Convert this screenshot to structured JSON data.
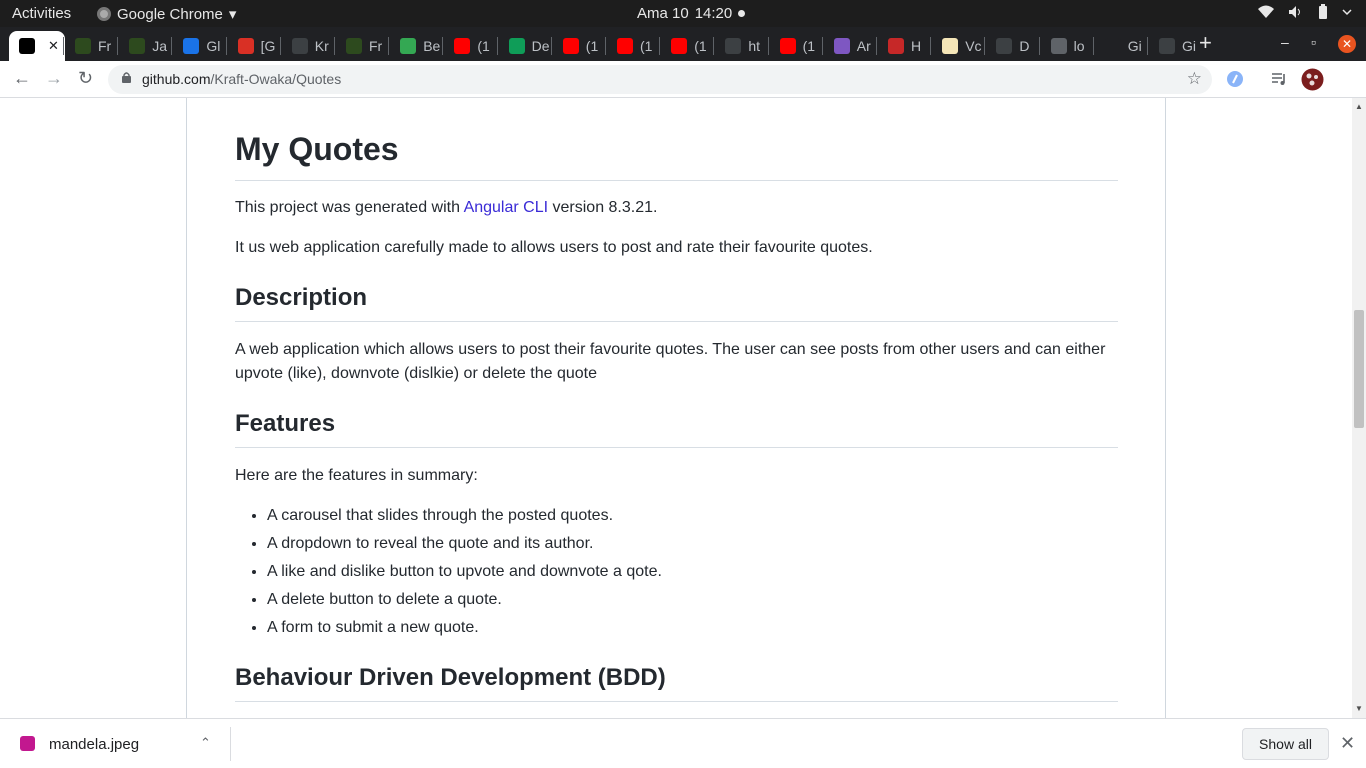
{
  "system": {
    "activities": "Activities",
    "app_name": "Google Chrome",
    "app_menu_arrow": "▾",
    "date": "Ama 10",
    "time": "14:20"
  },
  "tabs": [
    {
      "label": "",
      "active": true,
      "close": "✕",
      "icon": "github-icon",
      "color": "#000000"
    },
    {
      "label": "Fr",
      "icon": "palm-icon",
      "color": "#2d4a1e"
    },
    {
      "label": "Ja",
      "icon": "palm-icon",
      "color": "#2d4a1e"
    },
    {
      "label": "Gl",
      "icon": "gdoc-icon",
      "color": "#1a73e8"
    },
    {
      "label": "[G",
      "icon": "gmail-icon",
      "color": "#d93025"
    },
    {
      "label": "Kr",
      "icon": "github-icon",
      "color": "#3c4043"
    },
    {
      "label": "Fr",
      "icon": "palm-icon",
      "color": "#2d4a1e"
    },
    {
      "label": "Be",
      "icon": "leaf-icon",
      "color": "#34a853"
    },
    {
      "label": "(1",
      "icon": "youtube-icon",
      "color": "#ff0000"
    },
    {
      "label": "De",
      "icon": "stack-icon",
      "color": "#0f9d58"
    },
    {
      "label": "(1",
      "icon": "youtube-icon",
      "color": "#ff0000"
    },
    {
      "label": "(1",
      "icon": "youtube-icon",
      "color": "#ff0000"
    },
    {
      "label": "(1",
      "icon": "youtube-icon",
      "color": "#ff0000"
    },
    {
      "label": "ht",
      "icon": "globe-icon",
      "color": "#3c4043"
    },
    {
      "label": "(1",
      "icon": "youtube-icon",
      "color": "#ff0000"
    },
    {
      "label": "Ar",
      "icon": "react-icon",
      "color": "#7e57c2"
    },
    {
      "label": "H",
      "icon": "heroku-icon",
      "color": "#c62828"
    },
    {
      "label": "Vc",
      "icon": "grammar-icon",
      "color": "#f5e6b8"
    },
    {
      "label": "D",
      "icon": "github-icon",
      "color": "#3c4043"
    },
    {
      "label": "lo",
      "icon": "globe-icon",
      "color": "#5f6368"
    },
    {
      "label": "Gi",
      "icon": "angular-icon",
      "color": "#202124"
    },
    {
      "label": "Gi",
      "icon": "github-icon",
      "color": "#3c4043"
    }
  ],
  "new_tab": "+",
  "window": {
    "minimize": "–",
    "maximize": "▫",
    "close": "✕"
  },
  "toolbar": {
    "back": "←",
    "forward": "→",
    "reload": "↻",
    "url_domain": "github.com",
    "url_path": "/Kraft-Owaka/Quotes",
    "star": "☆"
  },
  "readme": {
    "title": "My Quotes",
    "intro_prefix": "This project was generated with ",
    "intro_link": "Angular CLI",
    "intro_suffix": " version 8.3.21.",
    "intro_2": "It us web application carefully made to allows users to post and rate their favourite quotes.",
    "description_heading": "Description",
    "description_text": "A web application which allows users to post their favourite quotes. The user can see posts from other users and can either upvote (like), downvote (dislkie) or delete the quote",
    "features_heading": "Features",
    "features_intro": "Here are the features in summary:",
    "features": [
      "A carousel that slides through the posted quotes.",
      "A dropdown to reveal the quote and its author.",
      "A like and dislike button to upvote and downvote a qote.",
      "A delete button to delete a quote.",
      "A form to submit a new quote."
    ],
    "bdd_heading": "Behaviour Driven Development (BDD)"
  },
  "downloads": {
    "file_name": "mandela.jpeg",
    "chevron": "⌃",
    "show_all": "Show all",
    "close": "✕"
  }
}
